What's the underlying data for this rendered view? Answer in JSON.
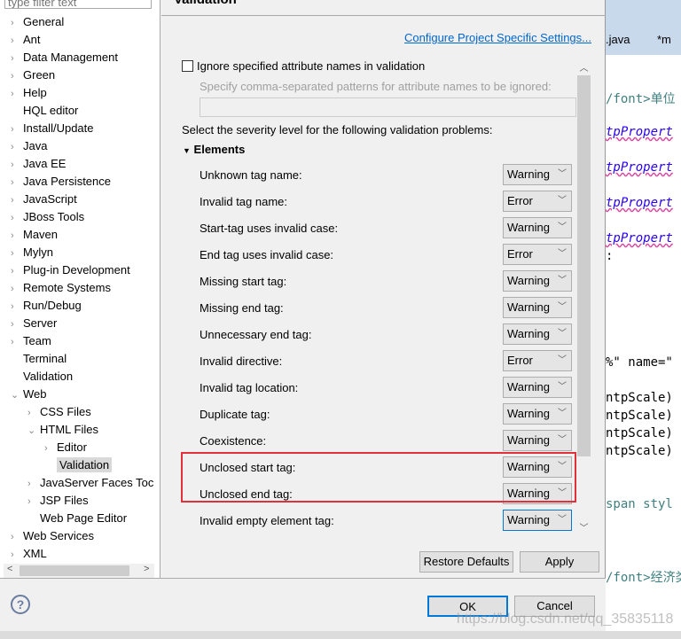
{
  "editor": {
    "tabs": [
      ".java",
      "*m"
    ],
    "lines": [
      {
        "t": "/font>单位",
        "c": ""
      },
      {
        "t": "tpPropert",
        "c": "it"
      },
      {
        "t": "tpPropert",
        "c": "it"
      },
      {
        "t": "tpPropert",
        "c": "it"
      },
      {
        "t": "tpPropert",
        "c": "it"
      },
      {
        "t": ":",
        "c": "plain"
      },
      {
        "t": "%\" name=\"",
        "c": "plain"
      },
      {
        "t": "ntpScale)",
        "c": "plain"
      },
      {
        "t": "ntpScale)",
        "c": "plain"
      },
      {
        "t": "ntpScale)",
        "c": "plain"
      },
      {
        "t": "ntpScale)",
        "c": "plain"
      },
      {
        "t": "span styl",
        "c": ""
      },
      {
        "t": "/font>经济类",
        "c": ""
      }
    ]
  },
  "tree": {
    "filter_placeholder": "type filter text",
    "items": [
      {
        "label": "General",
        "lvl": 0,
        "exp": ">"
      },
      {
        "label": "Ant",
        "lvl": 0,
        "exp": ">"
      },
      {
        "label": "Data Management",
        "lvl": 0,
        "exp": ">"
      },
      {
        "label": "Green",
        "lvl": 0,
        "exp": ">"
      },
      {
        "label": "Help",
        "lvl": 0,
        "exp": ">"
      },
      {
        "label": "HQL editor",
        "lvl": 0,
        "exp": ""
      },
      {
        "label": "Install/Update",
        "lvl": 0,
        "exp": ">"
      },
      {
        "label": "Java",
        "lvl": 0,
        "exp": ">"
      },
      {
        "label": "Java EE",
        "lvl": 0,
        "exp": ">"
      },
      {
        "label": "Java Persistence",
        "lvl": 0,
        "exp": ">"
      },
      {
        "label": "JavaScript",
        "lvl": 0,
        "exp": ">"
      },
      {
        "label": "JBoss Tools",
        "lvl": 0,
        "exp": ">"
      },
      {
        "label": "Maven",
        "lvl": 0,
        "exp": ">"
      },
      {
        "label": "Mylyn",
        "lvl": 0,
        "exp": ">"
      },
      {
        "label": "Plug-in Development",
        "lvl": 0,
        "exp": ">"
      },
      {
        "label": "Remote Systems",
        "lvl": 0,
        "exp": ">"
      },
      {
        "label": "Run/Debug",
        "lvl": 0,
        "exp": ">"
      },
      {
        "label": "Server",
        "lvl": 0,
        "exp": ">"
      },
      {
        "label": "Team",
        "lvl": 0,
        "exp": ">"
      },
      {
        "label": "Terminal",
        "lvl": 0,
        "exp": ""
      },
      {
        "label": "Validation",
        "lvl": 0,
        "exp": ""
      },
      {
        "label": "Web",
        "lvl": 0,
        "exp": "v"
      },
      {
        "label": "CSS Files",
        "lvl": 1,
        "exp": ">"
      },
      {
        "label": "HTML Files",
        "lvl": 1,
        "exp": "v"
      },
      {
        "label": "Editor",
        "lvl": 2,
        "exp": ">"
      },
      {
        "label": "Validation",
        "lvl": 2,
        "exp": "",
        "sel": true
      },
      {
        "label": "JavaServer Faces Toc",
        "lvl": 1,
        "exp": ">"
      },
      {
        "label": "JSP Files",
        "lvl": 1,
        "exp": ">"
      },
      {
        "label": "Web Page Editor",
        "lvl": 1,
        "exp": ""
      },
      {
        "label": "Web Services",
        "lvl": 0,
        "exp": ">"
      },
      {
        "label": "XML",
        "lvl": 0,
        "exp": ">"
      }
    ]
  },
  "main": {
    "title": "Validation",
    "configure_link": "Configure Project Specific Settings...",
    "ignore_checkbox": "Ignore specified attribute names in validation",
    "ignore_checked": false,
    "patterns_label": "Specify comma-separated patterns for attribute names to be ignored:",
    "patterns_value": "",
    "severity_label": "Select the severity level for the following validation problems:",
    "section": "Elements",
    "rows": [
      {
        "label": "Unknown tag name:",
        "value": "Warning"
      },
      {
        "label": "Invalid tag name:",
        "value": "Error"
      },
      {
        "label": "Start-tag uses invalid case:",
        "value": "Warning"
      },
      {
        "label": "End tag uses invalid case:",
        "value": "Error"
      },
      {
        "label": "Missing start tag:",
        "value": "Warning"
      },
      {
        "label": "Missing end tag:",
        "value": "Warning"
      },
      {
        "label": "Unnecessary end tag:",
        "value": "Warning"
      },
      {
        "label": "Invalid directive:",
        "value": "Error"
      },
      {
        "label": "Invalid tag location:",
        "value": "Warning"
      },
      {
        "label": "Duplicate tag:",
        "value": "Warning"
      },
      {
        "label": "Coexistence:",
        "value": "Warning"
      },
      {
        "label": "Unclosed start tag:",
        "value": "Warning"
      },
      {
        "label": "Unclosed end tag:",
        "value": "Warning"
      },
      {
        "label": "Invalid empty element tag:",
        "value": "Warning"
      }
    ],
    "highlight_color": "#e0303a",
    "restore_defaults": "Restore Defaults",
    "apply": "Apply"
  },
  "footer": {
    "ok": "OK",
    "cancel": "Cancel",
    "help_icon": "question-mark-icon"
  },
  "watermark": "https://blog.csdn.net/qq_35835118"
}
